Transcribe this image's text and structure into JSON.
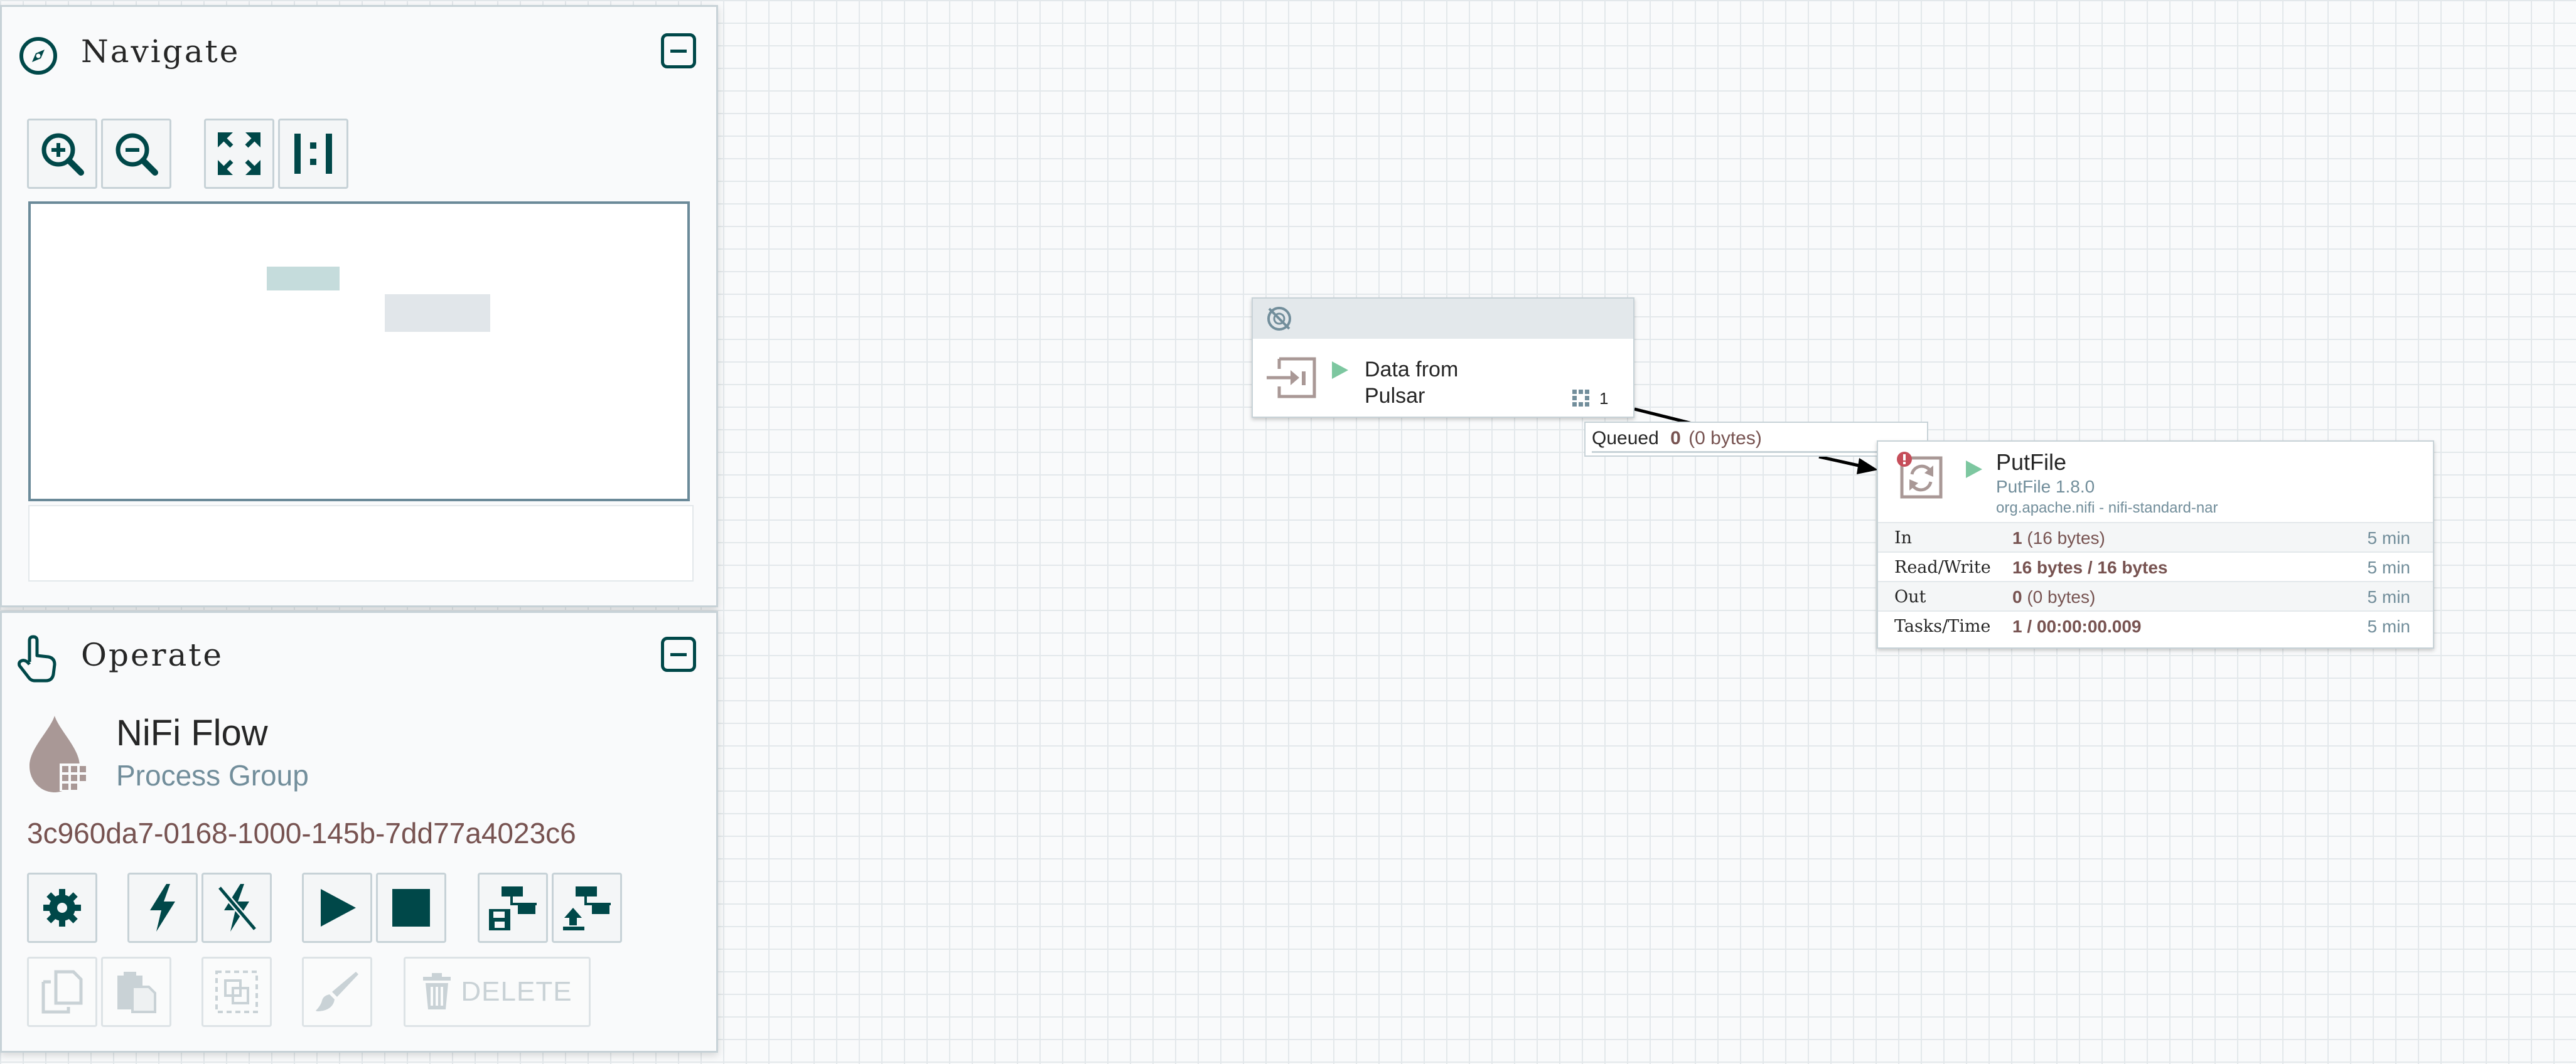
{
  "colors": {
    "accent": "#004849",
    "canvas_grid": "#e3e8eb",
    "value_color": "#775351",
    "muted_text": "#728e9b",
    "run_green": "#7dc7a0",
    "error_red": "#c64e5a"
  },
  "navigate": {
    "title": "Navigate",
    "icon": "compass-icon",
    "buttons": [
      {
        "name": "zoom-in-button",
        "icon": "zoom-in-icon"
      },
      {
        "name": "zoom-out-button",
        "icon": "zoom-out-icon"
      },
      {
        "name": "fit-button",
        "icon": "expand-icon"
      },
      {
        "name": "actual-size-button",
        "icon": "actual-size-icon"
      }
    ]
  },
  "operate": {
    "title": "Operate",
    "icon": "pointer-hand-icon",
    "group_name": "NiFi Flow",
    "group_type": "Process Group",
    "group_id": "3c960da7-0168-1000-145b-7dd77a4023c6",
    "delete_label": "DELETE"
  },
  "canvas": {
    "input_port": {
      "name": "Data from\nPulsar",
      "transmitting_icon": "not-transmitting-icon",
      "connections_count": "1"
    },
    "connection": {
      "queued_label": "Queued",
      "queued_count": "0",
      "queued_size": "(0 bytes)"
    },
    "processor": {
      "name": "PutFile",
      "type": "PutFile 1.8.0",
      "bundle": "org.apache.nifi - nifi-standard-nar",
      "stats": [
        {
          "label": "In",
          "value_bold": "1",
          "value_rest": " (16 bytes)",
          "time": "5 min"
        },
        {
          "label": "Read/Write",
          "value_bold": "16 bytes / 16 bytes",
          "value_rest": "",
          "time": "5 min"
        },
        {
          "label": "Out",
          "value_bold": "0",
          "value_rest": " (0 bytes)",
          "time": "5 min"
        },
        {
          "label": "Tasks/Time",
          "value_bold": "1 / 00:00:00.009",
          "value_rest": "",
          "time": "5 min"
        }
      ]
    }
  }
}
